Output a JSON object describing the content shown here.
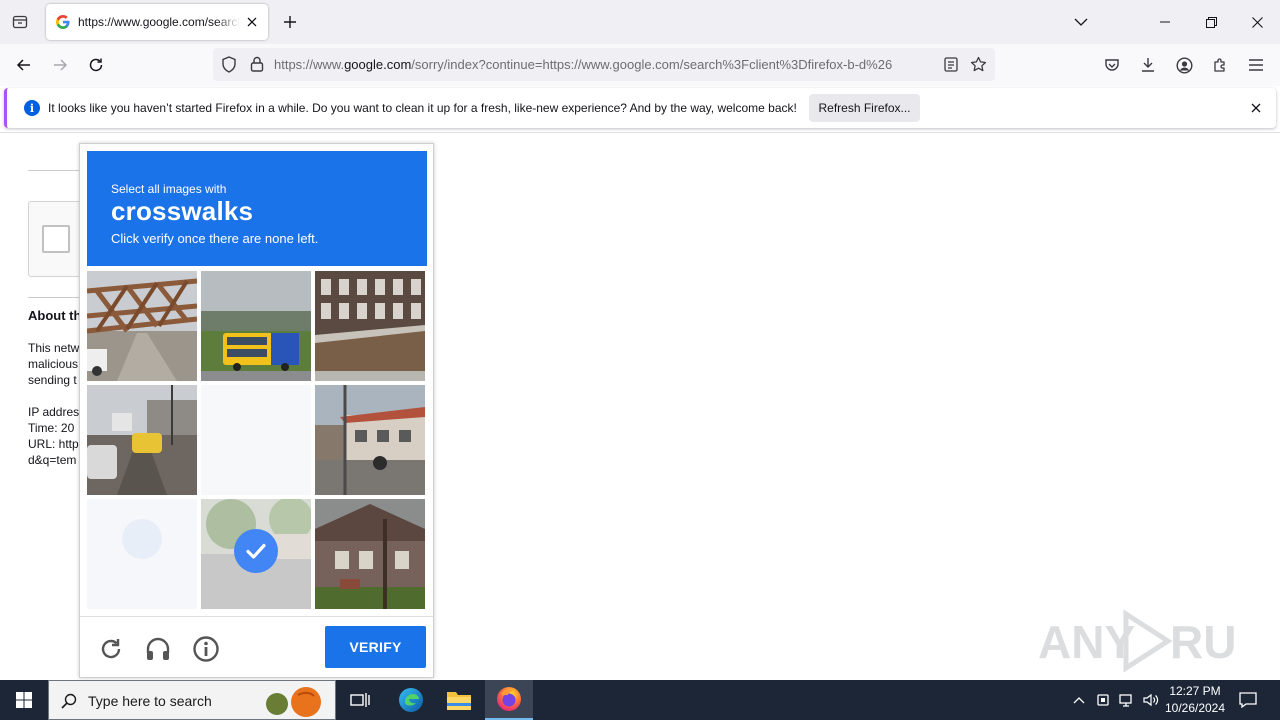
{
  "browser": {
    "tab": {
      "title": "https://www.google.com/search?client=firefox-b-d"
    },
    "address": {
      "scheme": "https://www.",
      "host": "google.com",
      "path": "/sorry/index?continue=https://www.google.com/search%3Fclient%3Dfirefox-b-d%26"
    }
  },
  "notification": {
    "message": "It looks like you haven’t started Firefox in a while. Do you want to clean it up for a fresh, like-new experience? And by the way, welcome back!",
    "button_label": "Refresh Firefox..."
  },
  "page": {
    "about_heading": "About th",
    "para_lines": [
      "This netw",
      "malicious",
      "sending t"
    ],
    "info_lines": [
      "IP addres",
      "Time: 20",
      "URL: http",
      "d&q=tem"
    ]
  },
  "captcha": {
    "line1": "Select all images with",
    "target": "crosswalks",
    "line3": "Click verify once there are none left.",
    "verify_label": "VERIFY",
    "tiles": [
      {
        "subject": "bridge-truss",
        "state": "unselected"
      },
      {
        "subject": "bus",
        "state": "unselected"
      },
      {
        "subject": "building-wall",
        "state": "unselected"
      },
      {
        "subject": "street-taxi",
        "state": "unselected"
      },
      {
        "subject": "blank",
        "state": "fading"
      },
      {
        "subject": "street-houses",
        "state": "unselected"
      },
      {
        "subject": "blank",
        "state": "fading"
      },
      {
        "subject": "road",
        "state": "selected"
      },
      {
        "subject": "house",
        "state": "unselected"
      }
    ]
  },
  "taskbar": {
    "search_placeholder": "Type here to search",
    "time": "12:27 PM",
    "date": "10/26/2024"
  },
  "watermark": "ANY RUN"
}
